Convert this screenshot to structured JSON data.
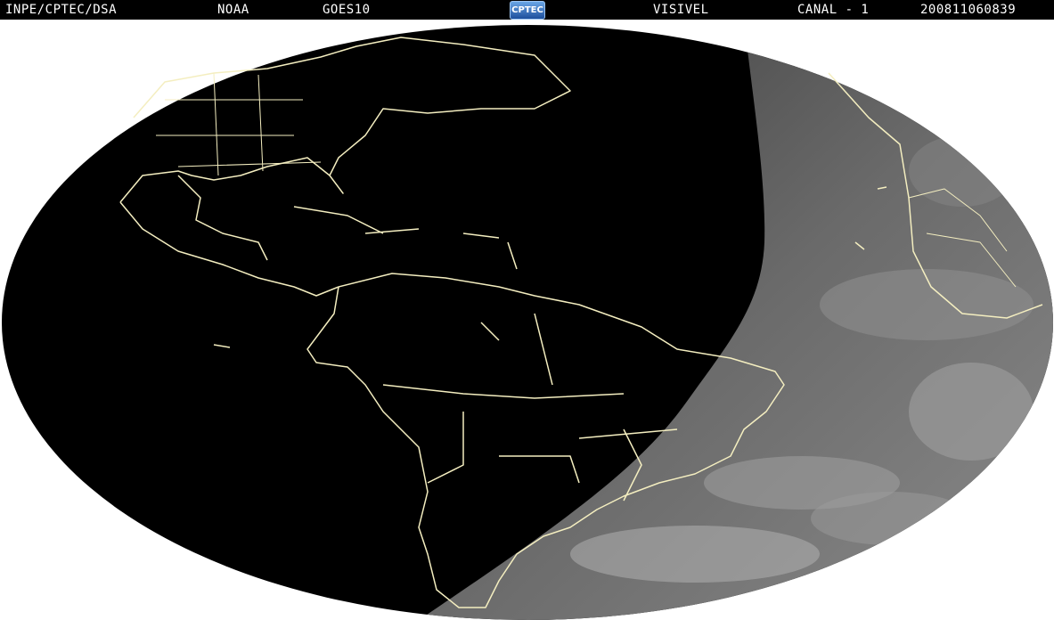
{
  "header": {
    "source": "INPE/CPTEC/DSA",
    "agency": "NOAA",
    "satellite": "GOES10",
    "logo_text": "CPTEC",
    "band": "VISIVEL",
    "channel": "CANAL - 1",
    "timestamp": "200811060839"
  },
  "colors": {
    "background": "#ffffff",
    "night_side": "#000000",
    "day_side": "#5f5f5f",
    "coastline": "#f4eec0"
  },
  "icons": {
    "logo": "cptec-logo"
  }
}
